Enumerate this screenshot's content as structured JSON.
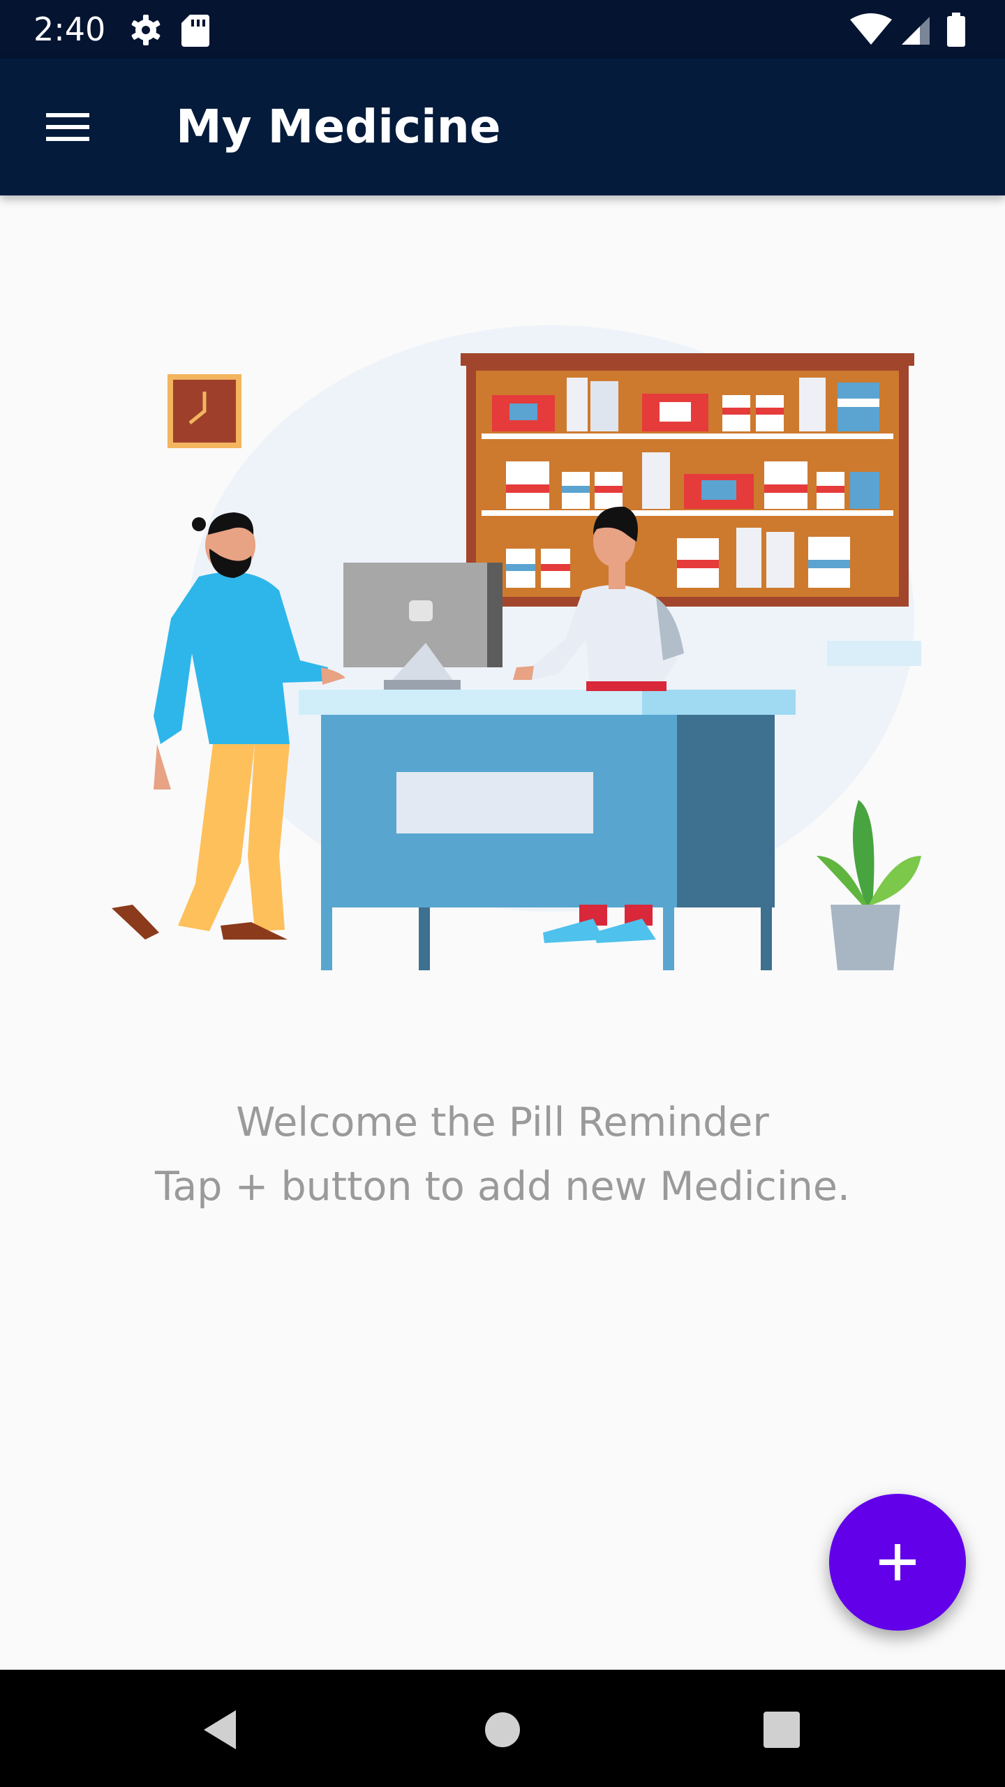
{
  "status_bar": {
    "time": "2:40",
    "left_icons": [
      "settings-icon",
      "sd-card-icon"
    ],
    "right_icons": [
      "wifi-icon",
      "cellular-signal-icon",
      "battery-icon"
    ]
  },
  "app_bar": {
    "title": "My Medicine",
    "menu_icon": "menu-icon"
  },
  "main": {
    "illustration": "pharmacy-counter-illustration",
    "welcome_line1": "Welcome the Pill Reminder",
    "welcome_line2": "Tap + button to add new Medicine."
  },
  "fab": {
    "icon": "plus-icon",
    "color": "#6200ea"
  },
  "nav_bar": {
    "items": [
      "back-icon",
      "home-icon",
      "recents-icon"
    ]
  },
  "colors": {
    "status_bar": "#041431",
    "app_bar": "#041b3c",
    "background": "#fafafa",
    "text_muted": "#9a9a9a"
  }
}
